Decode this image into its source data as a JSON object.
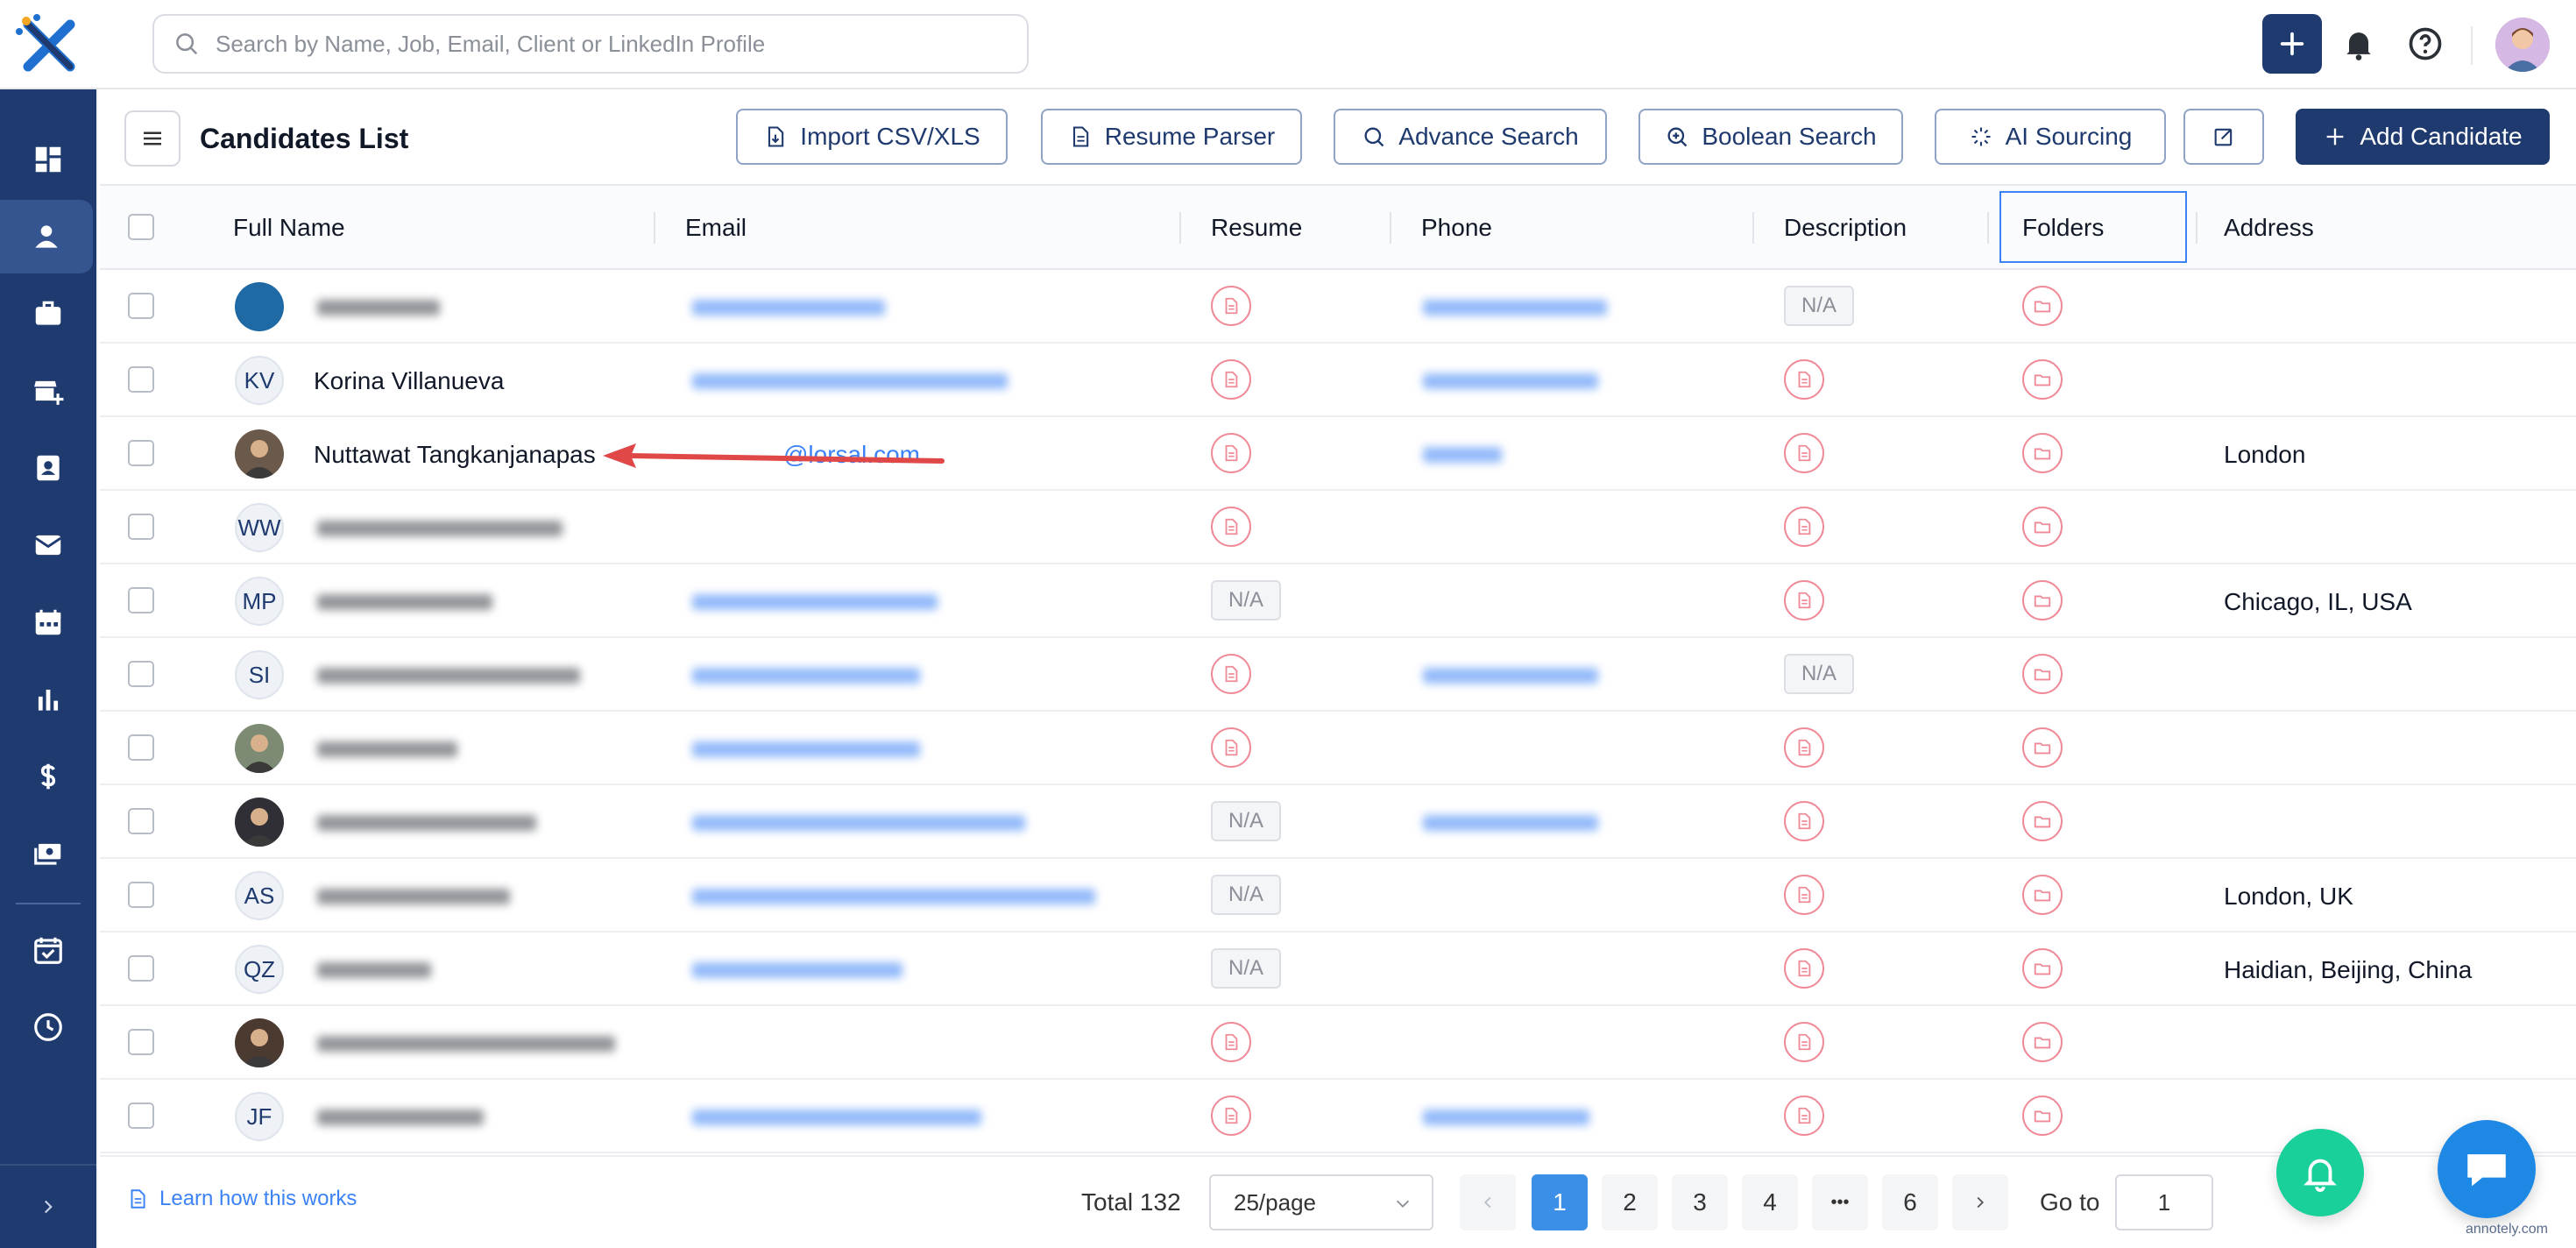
{
  "search": {
    "placeholder": "Search by Name, Job, Email, Client or LinkedIn Profile"
  },
  "header": {
    "title": "Candidates List"
  },
  "toolbar": {
    "import": "Import CSV/XLS",
    "resume_parser": "Resume Parser",
    "advance_search": "Advance Search",
    "boolean_search": "Boolean Search",
    "ai_sourcing": "AI Sourcing",
    "add_candidate": "Add Candidate"
  },
  "columns": {
    "full_name": "Full Name",
    "email": "Email",
    "resume": "Resume",
    "phone": "Phone",
    "description": "Description",
    "folders": "Folders",
    "address": "Address"
  },
  "rows": [
    {
      "initials": "",
      "name": "",
      "address": "",
      "resume": "icon",
      "description": "N/A"
    },
    {
      "initials": "KV",
      "name": "Korina Villanueva",
      "address": "",
      "resume": "icon",
      "description": "icon"
    },
    {
      "initials": "",
      "name": "Nuttawat Tangkanjanapas",
      "email": "@lorsal.com",
      "address": "London",
      "resume": "icon",
      "description": "icon"
    },
    {
      "initials": "WW",
      "name": "",
      "address": "",
      "resume": "icon",
      "description": "icon"
    },
    {
      "initials": "MP",
      "name": "",
      "address": "Chicago, IL, USA",
      "resume": "N/A",
      "description": "icon"
    },
    {
      "initials": "SI",
      "name": "",
      "address": "",
      "resume": "icon",
      "description": "N/A"
    },
    {
      "initials": "",
      "name": "",
      "address": "",
      "resume": "icon",
      "description": "icon"
    },
    {
      "initials": "",
      "name": "",
      "address": "",
      "resume": "N/A",
      "description": "icon"
    },
    {
      "initials": "AS",
      "name": "",
      "address": "London, UK",
      "resume": "N/A",
      "description": "icon"
    },
    {
      "initials": "QZ",
      "name": "",
      "address": "Haidian, Beijing, China",
      "resume": "N/A",
      "description": "icon"
    },
    {
      "initials": "",
      "name": "",
      "address": "",
      "resume": "icon",
      "description": "icon"
    },
    {
      "initials": "JF",
      "name": "",
      "address": "",
      "resume": "icon",
      "description": "icon"
    }
  ],
  "na_label": "N/A",
  "footer": {
    "learn": "Learn how this works",
    "total": "Total 132",
    "per_page": "25/page",
    "pages": [
      "1",
      "2",
      "3",
      "4",
      "•••",
      "6"
    ],
    "goto_label": "Go to",
    "goto_value": "1"
  },
  "watermark": "annotely.com",
  "colors": {
    "brand": "#1f3a6e",
    "accent": "#3b8fe6",
    "resume_icon": "#f08a98",
    "fab_green": "#19cf9a"
  }
}
